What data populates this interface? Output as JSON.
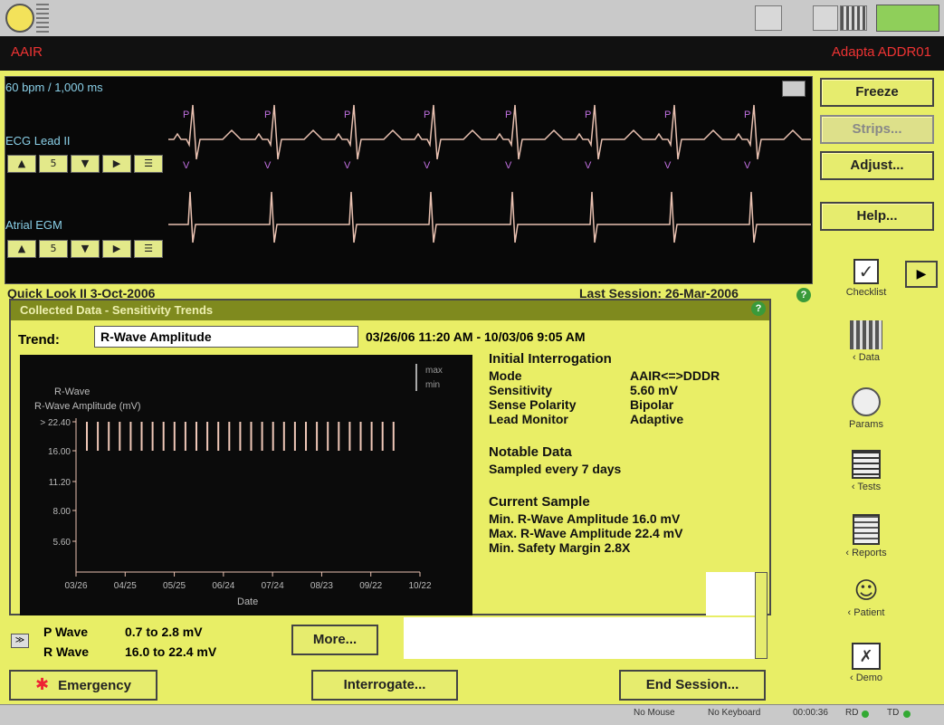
{
  "header": {
    "mode": "AAIR",
    "device": "Adapta ADDR01"
  },
  "ecg": {
    "rate": "60 bpm / 1,000 ms",
    "lead1": "ECG Lead II",
    "lead2": "Atrial EGM",
    "gain": "5",
    "p_marker": "P",
    "v_marker": "V"
  },
  "buttons": {
    "freeze": "Freeze",
    "strips": "Strips...",
    "adjust": "Adjust...",
    "help": "Help..."
  },
  "side": [
    {
      "label": "Checklist",
      "icon": "checklist-icon"
    },
    {
      "label": "‹ Data",
      "icon": "data-icon"
    },
    {
      "label": "Params",
      "icon": "params-icon"
    },
    {
      "label": "‹ Tests",
      "icon": "tests-icon"
    },
    {
      "label": "‹ Reports",
      "icon": "reports-icon"
    },
    {
      "label": "‹ Patient",
      "icon": "patient-icon"
    },
    {
      "label": "‹ Demo",
      "icon": "demo-icon"
    }
  ],
  "under": {
    "left": "Quick Look II  3-Oct-2006",
    "right": "Last Session: 26-Mar-2006"
  },
  "dialog": {
    "title": "Collected Data - Sensitivity Trends",
    "trend_label": "Trend:",
    "trend_value": "R-Wave Amplitude",
    "date_range": "03/26/06 11:20 AM - 10/03/06 9:05 AM",
    "initial": {
      "heading": "Initial Interrogation",
      "rows": [
        {
          "k": "Mode",
          "v": "AAIR<=>DDDR"
        },
        {
          "k": "Sensitivity",
          "v": "5.60 mV"
        },
        {
          "k": "Sense Polarity",
          "v": "Bipolar"
        },
        {
          "k": "Lead Monitor",
          "v": "Adaptive"
        }
      ]
    },
    "notable": {
      "heading": "Notable Data",
      "text": "Sampled every 7 days"
    },
    "current": {
      "heading": "Current Sample",
      "lines": [
        "Min. R-Wave Amplitude 16.0 mV",
        "Max. R-Wave Amplitude 22.4 mV",
        "Min. Safety Margin 2.8X"
      ]
    }
  },
  "chart_data": {
    "type": "bar",
    "ylabel": "R-Wave Amplitude (mV)",
    "xlabel": "Date",
    "legend": [
      "max",
      "min"
    ],
    "yticks": [
      "22.40",
      "16.00",
      "11.20",
      "8.00",
      "5.60"
    ],
    "xticks": [
      "03/26",
      "04/25",
      "05/25",
      "06/24",
      "07/24",
      "08/23",
      "09/22",
      "10/22"
    ],
    "ymin_value": 16.0,
    "ymax_value": 22.4,
    "n_samples": 29
  },
  "summary": {
    "p_label": "P Wave",
    "p_value": "0.7 to 2.8 mV",
    "r_label": "R Wave",
    "r_value": "16.0 to 22.4 mV",
    "more": "More..."
  },
  "footer": {
    "emergency": "Emergency",
    "interrogate": "Interrogate...",
    "end": "End Session..."
  },
  "status": {
    "mouse": "No Mouse",
    "keyboard": "No Keyboard",
    "time": "00:00:36",
    "rd": "RD",
    "td": "TD"
  }
}
